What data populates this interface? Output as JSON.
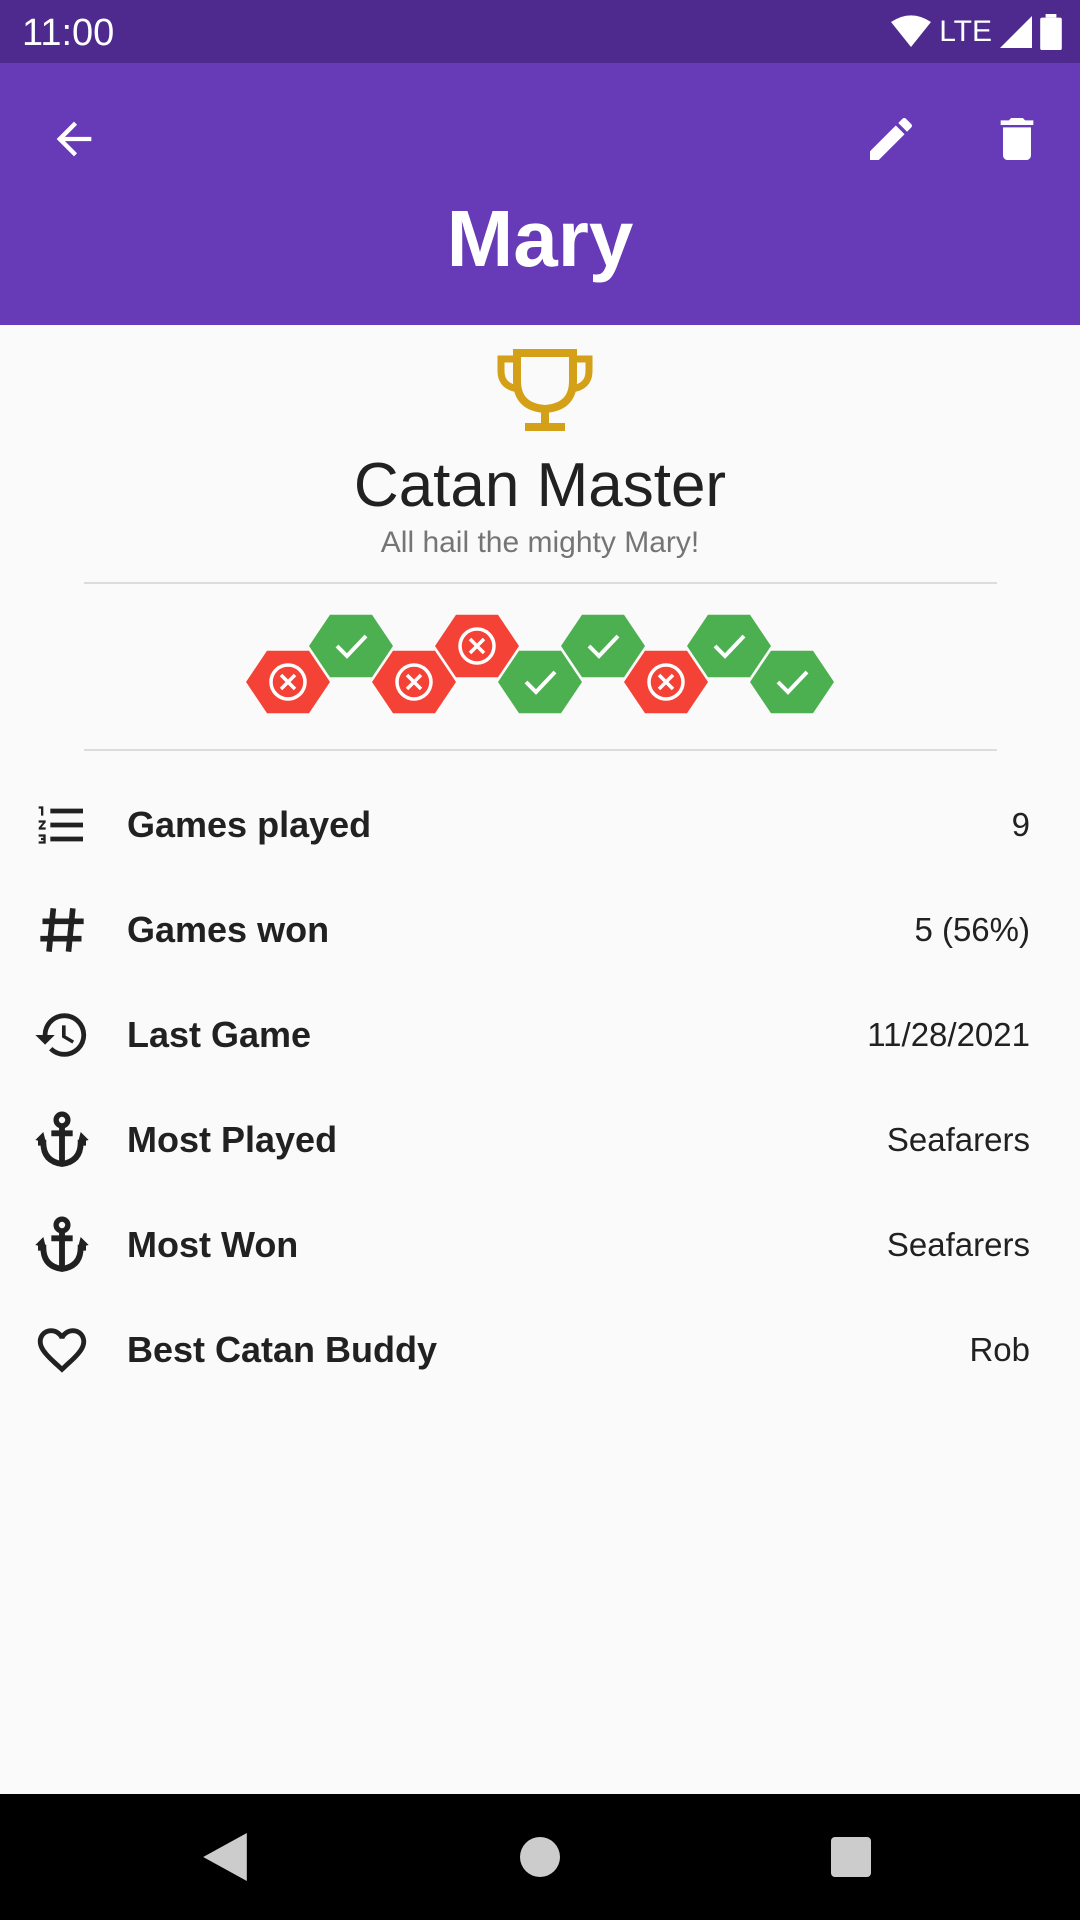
{
  "status_bar": {
    "time": "11:00",
    "network": "LTE"
  },
  "header": {
    "name": "Mary",
    "accent": "#673ab7",
    "status_color": "#4e2a8e"
  },
  "badge": {
    "icon": "trophy-icon",
    "title": "Catan Master",
    "subtitle": "All hail the mighty Mary!",
    "color": "#d4a017"
  },
  "results": {
    "win_color": "#4caf50",
    "loss_color": "#f44336",
    "games": [
      "loss",
      "win",
      "loss",
      "loss",
      "win",
      "win",
      "loss",
      "win",
      "win"
    ]
  },
  "stats": [
    {
      "icon": "numbered-list-icon",
      "label": "Games played",
      "value": "9"
    },
    {
      "icon": "hash-icon",
      "label": "Games won",
      "value": "5 (56%)"
    },
    {
      "icon": "history-icon",
      "label": "Last Game",
      "value": "11/28/2021"
    },
    {
      "icon": "anchor-icon",
      "label": "Most Played",
      "value": "Seafarers"
    },
    {
      "icon": "anchor-icon",
      "label": "Most Won",
      "value": "Seafarers"
    },
    {
      "icon": "heart-icon",
      "label": "Best Catan Buddy",
      "value": "Rob"
    }
  ]
}
